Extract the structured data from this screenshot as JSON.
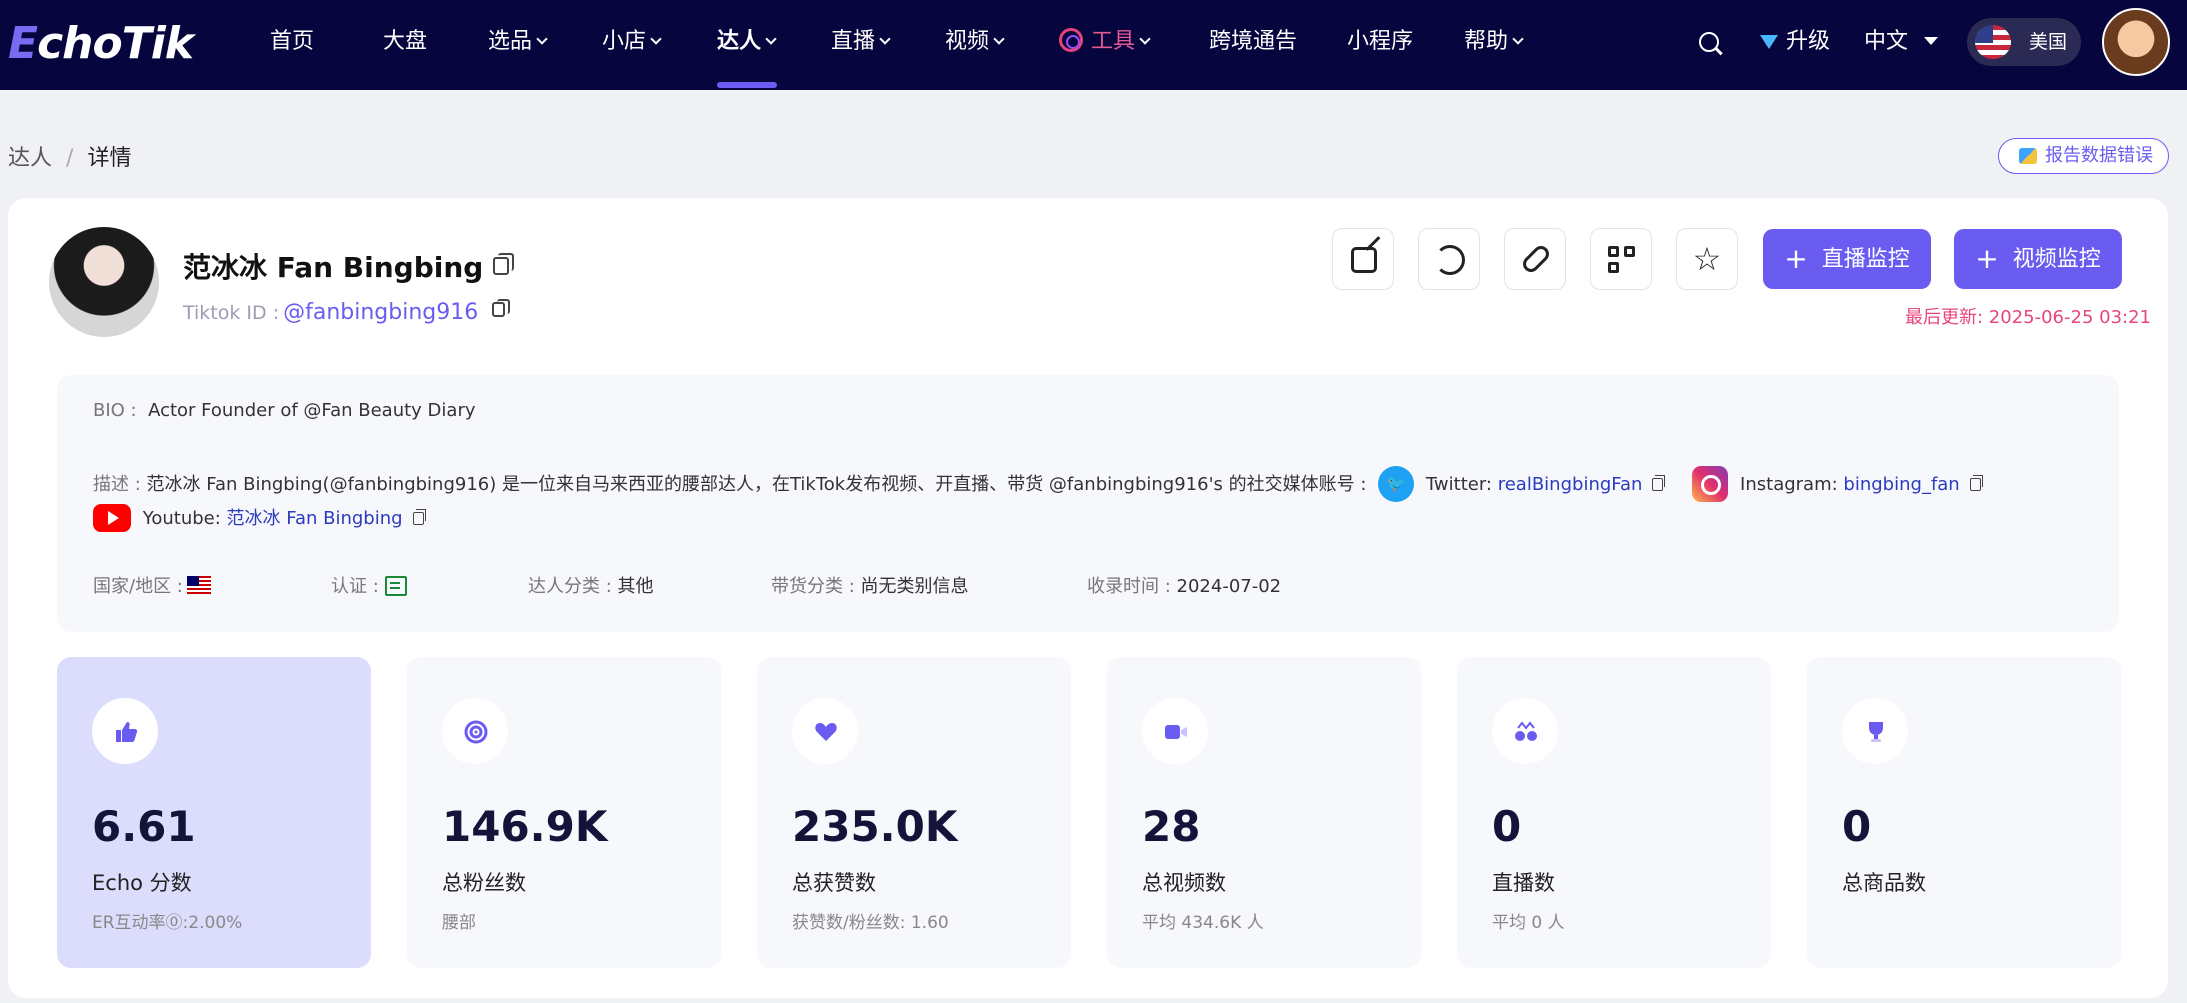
{
  "nav": {
    "logo": {
      "first": "E",
      "rest": "choTik"
    },
    "items": [
      "首页",
      "大盘",
      "选品",
      "小店",
      "达人",
      "直播",
      "视频",
      "工具",
      "跨境通告",
      "小程序",
      "帮助"
    ],
    "upgrade": "升级",
    "language": "中文",
    "region": "美国"
  },
  "breadcrumb": {
    "root": "达人",
    "separator": "/",
    "current": "详情"
  },
  "report_button": "报告数据错误",
  "profile": {
    "name": "范冰冰 Fan Bingbing",
    "tiktok_id_label": "Tiktok ID :",
    "handle": "@fanbingbing916",
    "updated": "最后更新: 2025-06-25 03:21"
  },
  "actions": {
    "live_monitor": "直播监控",
    "video_monitor": "视频监控"
  },
  "info": {
    "bio_label": "BIO :",
    "bio": "Actor Founder of @Fan Beauty Diary",
    "desc_label": "描述 :",
    "desc": "范冰冰 Fan Bingbing(@fanbingbing916) 是一位来自马来西亚的腰部达人，在TikTok发布视频、开直播、带货 @fanbingbing916's 的社交媒体账号 :",
    "twitter_label": "Twitter:",
    "twitter": "realBingbingFan",
    "instagram_label": "Instagram:",
    "instagram": "bingbing_fan",
    "youtube_label": "Youtube:",
    "youtube": "范冰冰 Fan Bingbing",
    "country_label": "国家/地区 :",
    "verify_label": "认证 :",
    "category_label": "达人分类 :",
    "category": "其他",
    "goods_label": "带货分类 :",
    "goods": "尚无类别信息",
    "indexed_label": "收录时间 :",
    "indexed": "2024-07-02"
  },
  "stats": [
    {
      "icon": "thumbs-up-icon",
      "value": "6.61",
      "label": "Echo 分数",
      "sub": "ER互动率⓪:2.00%"
    },
    {
      "icon": "target-icon",
      "value": "146.9K",
      "label": "总粉丝数",
      "sub": "腰部"
    },
    {
      "icon": "heart-icon",
      "value": "235.0K",
      "label": "总获赞数",
      "sub": "获赞数/粉丝数: 1.60"
    },
    {
      "icon": "video-icon",
      "value": "28",
      "label": "总视频数",
      "sub": "平均 434.6K 人"
    },
    {
      "icon": "live-icon",
      "value": "0",
      "label": "直播数",
      "sub": "平均 0 人"
    },
    {
      "icon": "trophy-icon",
      "value": "0",
      "label": "总商品数",
      "sub": ""
    }
  ],
  "colors": {
    "nav_bg": "#06053d",
    "accent": "#6b5cf1",
    "updated": "#e8457f",
    "highlight_card": "#dcddfc"
  }
}
